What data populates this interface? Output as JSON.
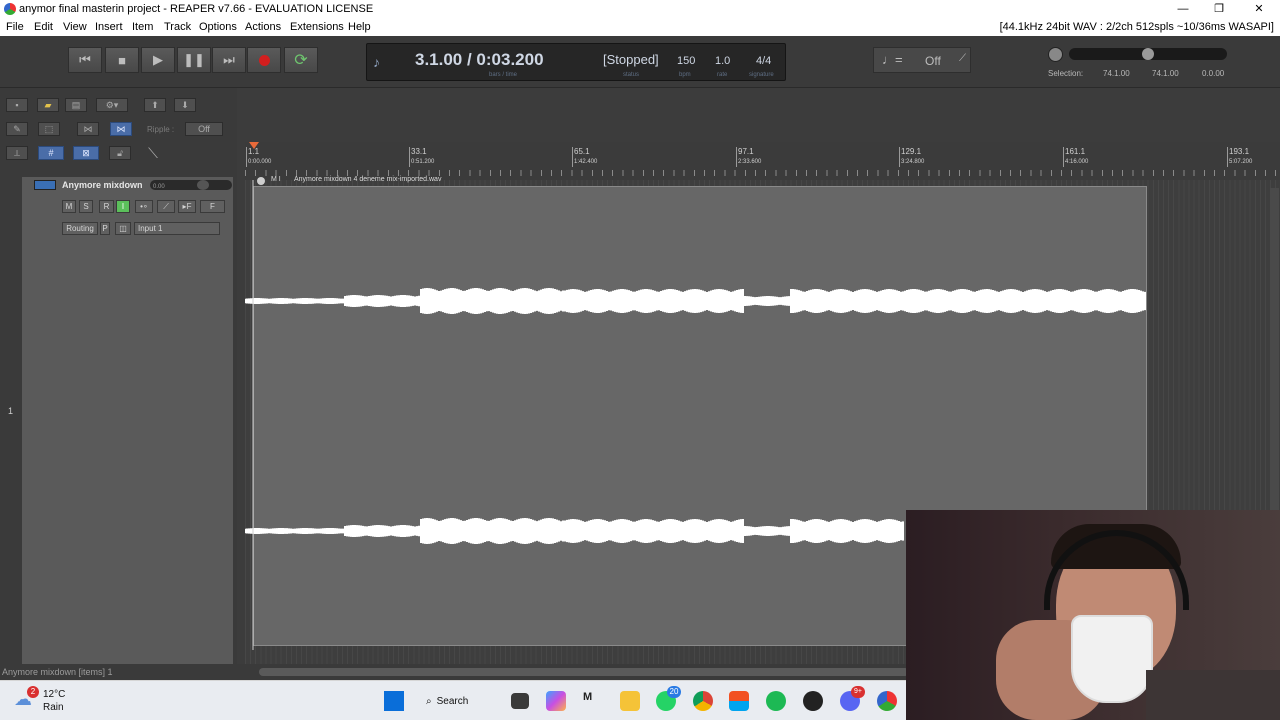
{
  "window": {
    "title": "anymor final masterin project - REAPER v7.66 - EVALUATION LICENSE",
    "minimize": "—",
    "restore": "❐",
    "close": "✕"
  },
  "menu": {
    "items": [
      "File",
      "Edit",
      "View",
      "Insert",
      "Item",
      "Track",
      "Options",
      "Actions",
      "Extensions",
      "Help"
    ],
    "audio_info": "[44.1kHz 24bit WAV : 2/2ch 512spls ~10/36ms WASAPI]"
  },
  "transport": {
    "position": "3.1.00 / 0:03.200",
    "state": "[Stopped]",
    "bpm": "150",
    "rate": "1.0",
    "signature": "4/4",
    "sub_position": "bars / time",
    "sub_status": "status",
    "sub_bpm": "bpm",
    "sub_rate": "rate",
    "sub_signature": "signature"
  },
  "tempo_box": {
    "value": "Off"
  },
  "selection": {
    "label": "Selection:",
    "start": "74.1.00",
    "end": "74.1.00",
    "length": "0.0.00"
  },
  "left_toolbar": {
    "ripple_label": "Ripple :",
    "ripple_value": "Off"
  },
  "track": {
    "number": "1",
    "name": "Anymore mixdown",
    "volume": "0.00",
    "buttons": [
      "M",
      "S",
      "R",
      "I"
    ],
    "fx_label": "F",
    "routing": "Routing",
    "input": "Input 1"
  },
  "ruler": {
    "marks": [
      {
        "bar": "1.1",
        "time": "0:00.000"
      },
      {
        "bar": "33.1",
        "time": "0:51.200"
      },
      {
        "bar": "65.1",
        "time": "1:42.400"
      },
      {
        "bar": "97.1",
        "time": "2:33.600"
      },
      {
        "bar": "129.1",
        "time": "3:24.800"
      },
      {
        "bar": "161.1",
        "time": "4:16.000"
      },
      {
        "bar": "193.1",
        "time": "5:07.200"
      }
    ]
  },
  "media_item": {
    "name": "Anymore mixdown 4 deneme mix-imported.wav",
    "flags": "M I"
  },
  "status_bar": {
    "text": "Anymore mixdown [items] 1"
  },
  "taskbar": {
    "weather_temp": "12°C",
    "weather_desc": "Rain",
    "weather_badge": "2",
    "search": "Search",
    "whatsapp_badge": "20",
    "discord_badge": "9+"
  }
}
